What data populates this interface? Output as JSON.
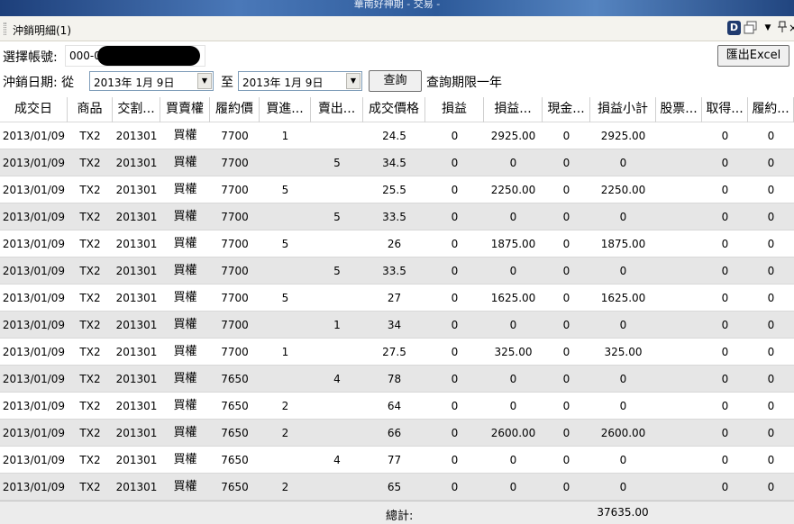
{
  "window": {
    "title": "華南好神期 - 交易 -"
  },
  "panel": {
    "title": "沖銷明細(1)",
    "d_icon_label": "D",
    "dropdown_glyph": "▼",
    "pin_glyph": "ᵖ",
    "close_glyph": "×"
  },
  "account": {
    "label": "選擇帳號:",
    "value": "000-0"
  },
  "date_filter": {
    "label": "沖銷日期: 從",
    "from": "2013年  1月  9日",
    "to_label": "至",
    "to": "2013年  1月  9日",
    "limit_note": "查詢期限一年"
  },
  "buttons": {
    "export": "匯出Excel",
    "query": "查詢"
  },
  "table": {
    "headers": [
      "成交日",
      "商品",
      "交割...",
      "買賣權",
      "履約價",
      "買進...",
      "賣出...",
      "成交價格",
      "損益",
      "損益...",
      "現金...",
      "損益小計",
      "股票...",
      "取得...",
      "履約..."
    ],
    "rows": [
      [
        "2013/01/09",
        "TX2",
        "201301",
        "買權",
        "7700",
        "1",
        "",
        "24.5",
        "0",
        "2925.00",
        "0",
        "2925.00",
        "",
        "0",
        "0"
      ],
      [
        "2013/01/09",
        "TX2",
        "201301",
        "買權",
        "7700",
        "",
        "5",
        "34.5",
        "0",
        "0",
        "0",
        "0",
        "",
        "0",
        "0"
      ],
      [
        "2013/01/09",
        "TX2",
        "201301",
        "買權",
        "7700",
        "5",
        "",
        "25.5",
        "0",
        "2250.00",
        "0",
        "2250.00",
        "",
        "0",
        "0"
      ],
      [
        "2013/01/09",
        "TX2",
        "201301",
        "買權",
        "7700",
        "",
        "5",
        "33.5",
        "0",
        "0",
        "0",
        "0",
        "",
        "0",
        "0"
      ],
      [
        "2013/01/09",
        "TX2",
        "201301",
        "買權",
        "7700",
        "5",
        "",
        "26",
        "0",
        "1875.00",
        "0",
        "1875.00",
        "",
        "0",
        "0"
      ],
      [
        "2013/01/09",
        "TX2",
        "201301",
        "買權",
        "7700",
        "",
        "5",
        "33.5",
        "0",
        "0",
        "0",
        "0",
        "",
        "0",
        "0"
      ],
      [
        "2013/01/09",
        "TX2",
        "201301",
        "買權",
        "7700",
        "5",
        "",
        "27",
        "0",
        "1625.00",
        "0",
        "1625.00",
        "",
        "0",
        "0"
      ],
      [
        "2013/01/09",
        "TX2",
        "201301",
        "買權",
        "7700",
        "",
        "1",
        "34",
        "0",
        "0",
        "0",
        "0",
        "",
        "0",
        "0"
      ],
      [
        "2013/01/09",
        "TX2",
        "201301",
        "買權",
        "7700",
        "1",
        "",
        "27.5",
        "0",
        "325.00",
        "0",
        "325.00",
        "",
        "0",
        "0"
      ],
      [
        "2013/01/09",
        "TX2",
        "201301",
        "買權",
        "7650",
        "",
        "4",
        "78",
        "0",
        "0",
        "0",
        "0",
        "",
        "0",
        "0"
      ],
      [
        "2013/01/09",
        "TX2",
        "201301",
        "買權",
        "7650",
        "2",
        "",
        "64",
        "0",
        "0",
        "0",
        "0",
        "",
        "0",
        "0"
      ],
      [
        "2013/01/09",
        "TX2",
        "201301",
        "買權",
        "7650",
        "2",
        "",
        "66",
        "0",
        "2600.00",
        "0",
        "2600.00",
        "",
        "0",
        "0"
      ],
      [
        "2013/01/09",
        "TX2",
        "201301",
        "買權",
        "7650",
        "",
        "4",
        "77",
        "0",
        "0",
        "0",
        "0",
        "",
        "0",
        "0"
      ],
      [
        "2013/01/09",
        "TX2",
        "201301",
        "買權",
        "7650",
        "2",
        "",
        "65",
        "0",
        "0",
        "0",
        "0",
        "",
        "0",
        "0"
      ]
    ]
  },
  "footer": {
    "total_label": "總計:",
    "total_value": "37635.00"
  },
  "colors": {
    "row_alt": "#e6e6e6",
    "title_bar": "#2d5a9a"
  }
}
